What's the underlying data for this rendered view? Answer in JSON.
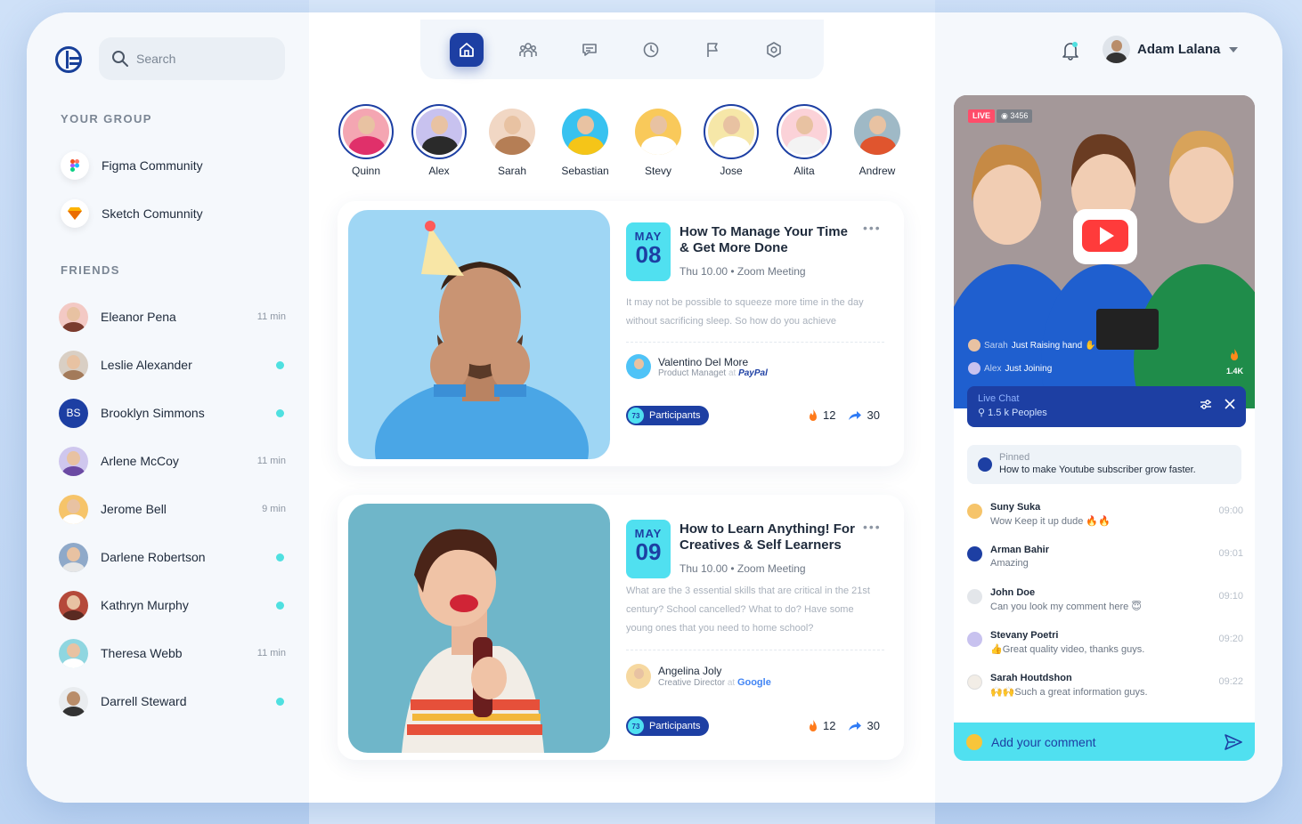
{
  "sidebar": {
    "search_placeholder": "Search",
    "group_title": "YOUR GROUP",
    "groups": [
      {
        "label": "Figma Community",
        "icon": "figma-icon"
      },
      {
        "label": "Sketch Comunnity",
        "icon": "sketch-icon"
      }
    ],
    "friends_title": "FRIENDS",
    "friends": [
      {
        "name": "Eleanor Pena",
        "status": "11 min",
        "online": false
      },
      {
        "name": "Leslie Alexander",
        "status": "",
        "online": true
      },
      {
        "name": "Brooklyn Simmons",
        "status": "",
        "online": true,
        "initials": "BS"
      },
      {
        "name": "Arlene McCoy",
        "status": "11 min",
        "online": false
      },
      {
        "name": "Jerome Bell",
        "status": "9 min",
        "online": false
      },
      {
        "name": "Darlene Robertson",
        "status": "",
        "online": true
      },
      {
        "name": "Kathryn Murphy",
        "status": "",
        "online": true
      },
      {
        "name": "Theresa Webb",
        "status": "11 min",
        "online": false
      },
      {
        "name": "Darrell Steward",
        "status": "",
        "online": true
      }
    ]
  },
  "topnav": {
    "items": [
      "home-icon",
      "group-icon",
      "chat-icon",
      "clock-icon",
      "flag-icon",
      "settings-icon"
    ],
    "active": "home-icon"
  },
  "stories": [
    "Quinn",
    "Alex",
    "Sarah",
    "Sebastian",
    "Stevy",
    "Jose",
    "Alita",
    "Andrew"
  ],
  "events": [
    {
      "month": "MAY",
      "day": "08",
      "title": "How To Manage Your Time & Get More Done",
      "meta": "Thu 10.00 • Zoom Meeting",
      "desc": "It may not be possible to squeeze more time in the day without sacrificing sleep. So how do you achieve",
      "host": "Valentino Del More",
      "role": "Product Managet",
      "at": "at",
      "company": "PayPal",
      "participants_count": "73",
      "participants_label": "Participants",
      "fire": "12",
      "shares": "30"
    },
    {
      "month": "MAY",
      "day": "09",
      "title": "How to Learn Anything! For Creatives & Self Learners",
      "meta": "Thu 10.00 • Zoom Meeting",
      "desc": "What are the 3 essential skills that are critical in the 21st century? School cancelled? What to do? Have some young ones that you need to home school?",
      "host": "Angelina Joly",
      "role": "Creative Director",
      "at": "at",
      "company": "Google",
      "participants_count": "73",
      "participants_label": "Participants",
      "fire": "12",
      "shares": "30"
    }
  ],
  "header": {
    "user_name": "Adam Lalana"
  },
  "live": {
    "badge": "LIVE",
    "viewers": "3456",
    "joins": [
      {
        "name": "Sarah",
        "text": "Just Raising hand ✋"
      },
      {
        "name": "Alex",
        "text": "Just Joining"
      }
    ],
    "fire_count": "1.4K",
    "chat_title": "Live Chat",
    "chat_people": "1.5 k Peoples",
    "pinned_label": "Pinned",
    "pinned_text": "How to make Youtube subscriber grow faster.",
    "messages": [
      {
        "name": "Suny Suka",
        "text": "Wow Keep it up dude 🔥🔥",
        "time": "09:00"
      },
      {
        "name": "Arman Bahir",
        "text": "Amazing",
        "time": "09:01"
      },
      {
        "name": "John Doe",
        "text": "Can you look my comment here 😇",
        "time": "09:10"
      },
      {
        "name": "Stevany Poetri",
        "text": "👍Great quality video, thanks guys.",
        "time": "09:20"
      },
      {
        "name": "Sarah Houtdshon",
        "text": "🙌🙌Such a great information guys.",
        "time": "09:22"
      }
    ],
    "comment_placeholder": "Add your comment"
  },
  "colors": {
    "primary": "#1d3fa3",
    "accent": "#50e0f0",
    "online": "#4fe0e0",
    "live": "#ff4d6a"
  }
}
